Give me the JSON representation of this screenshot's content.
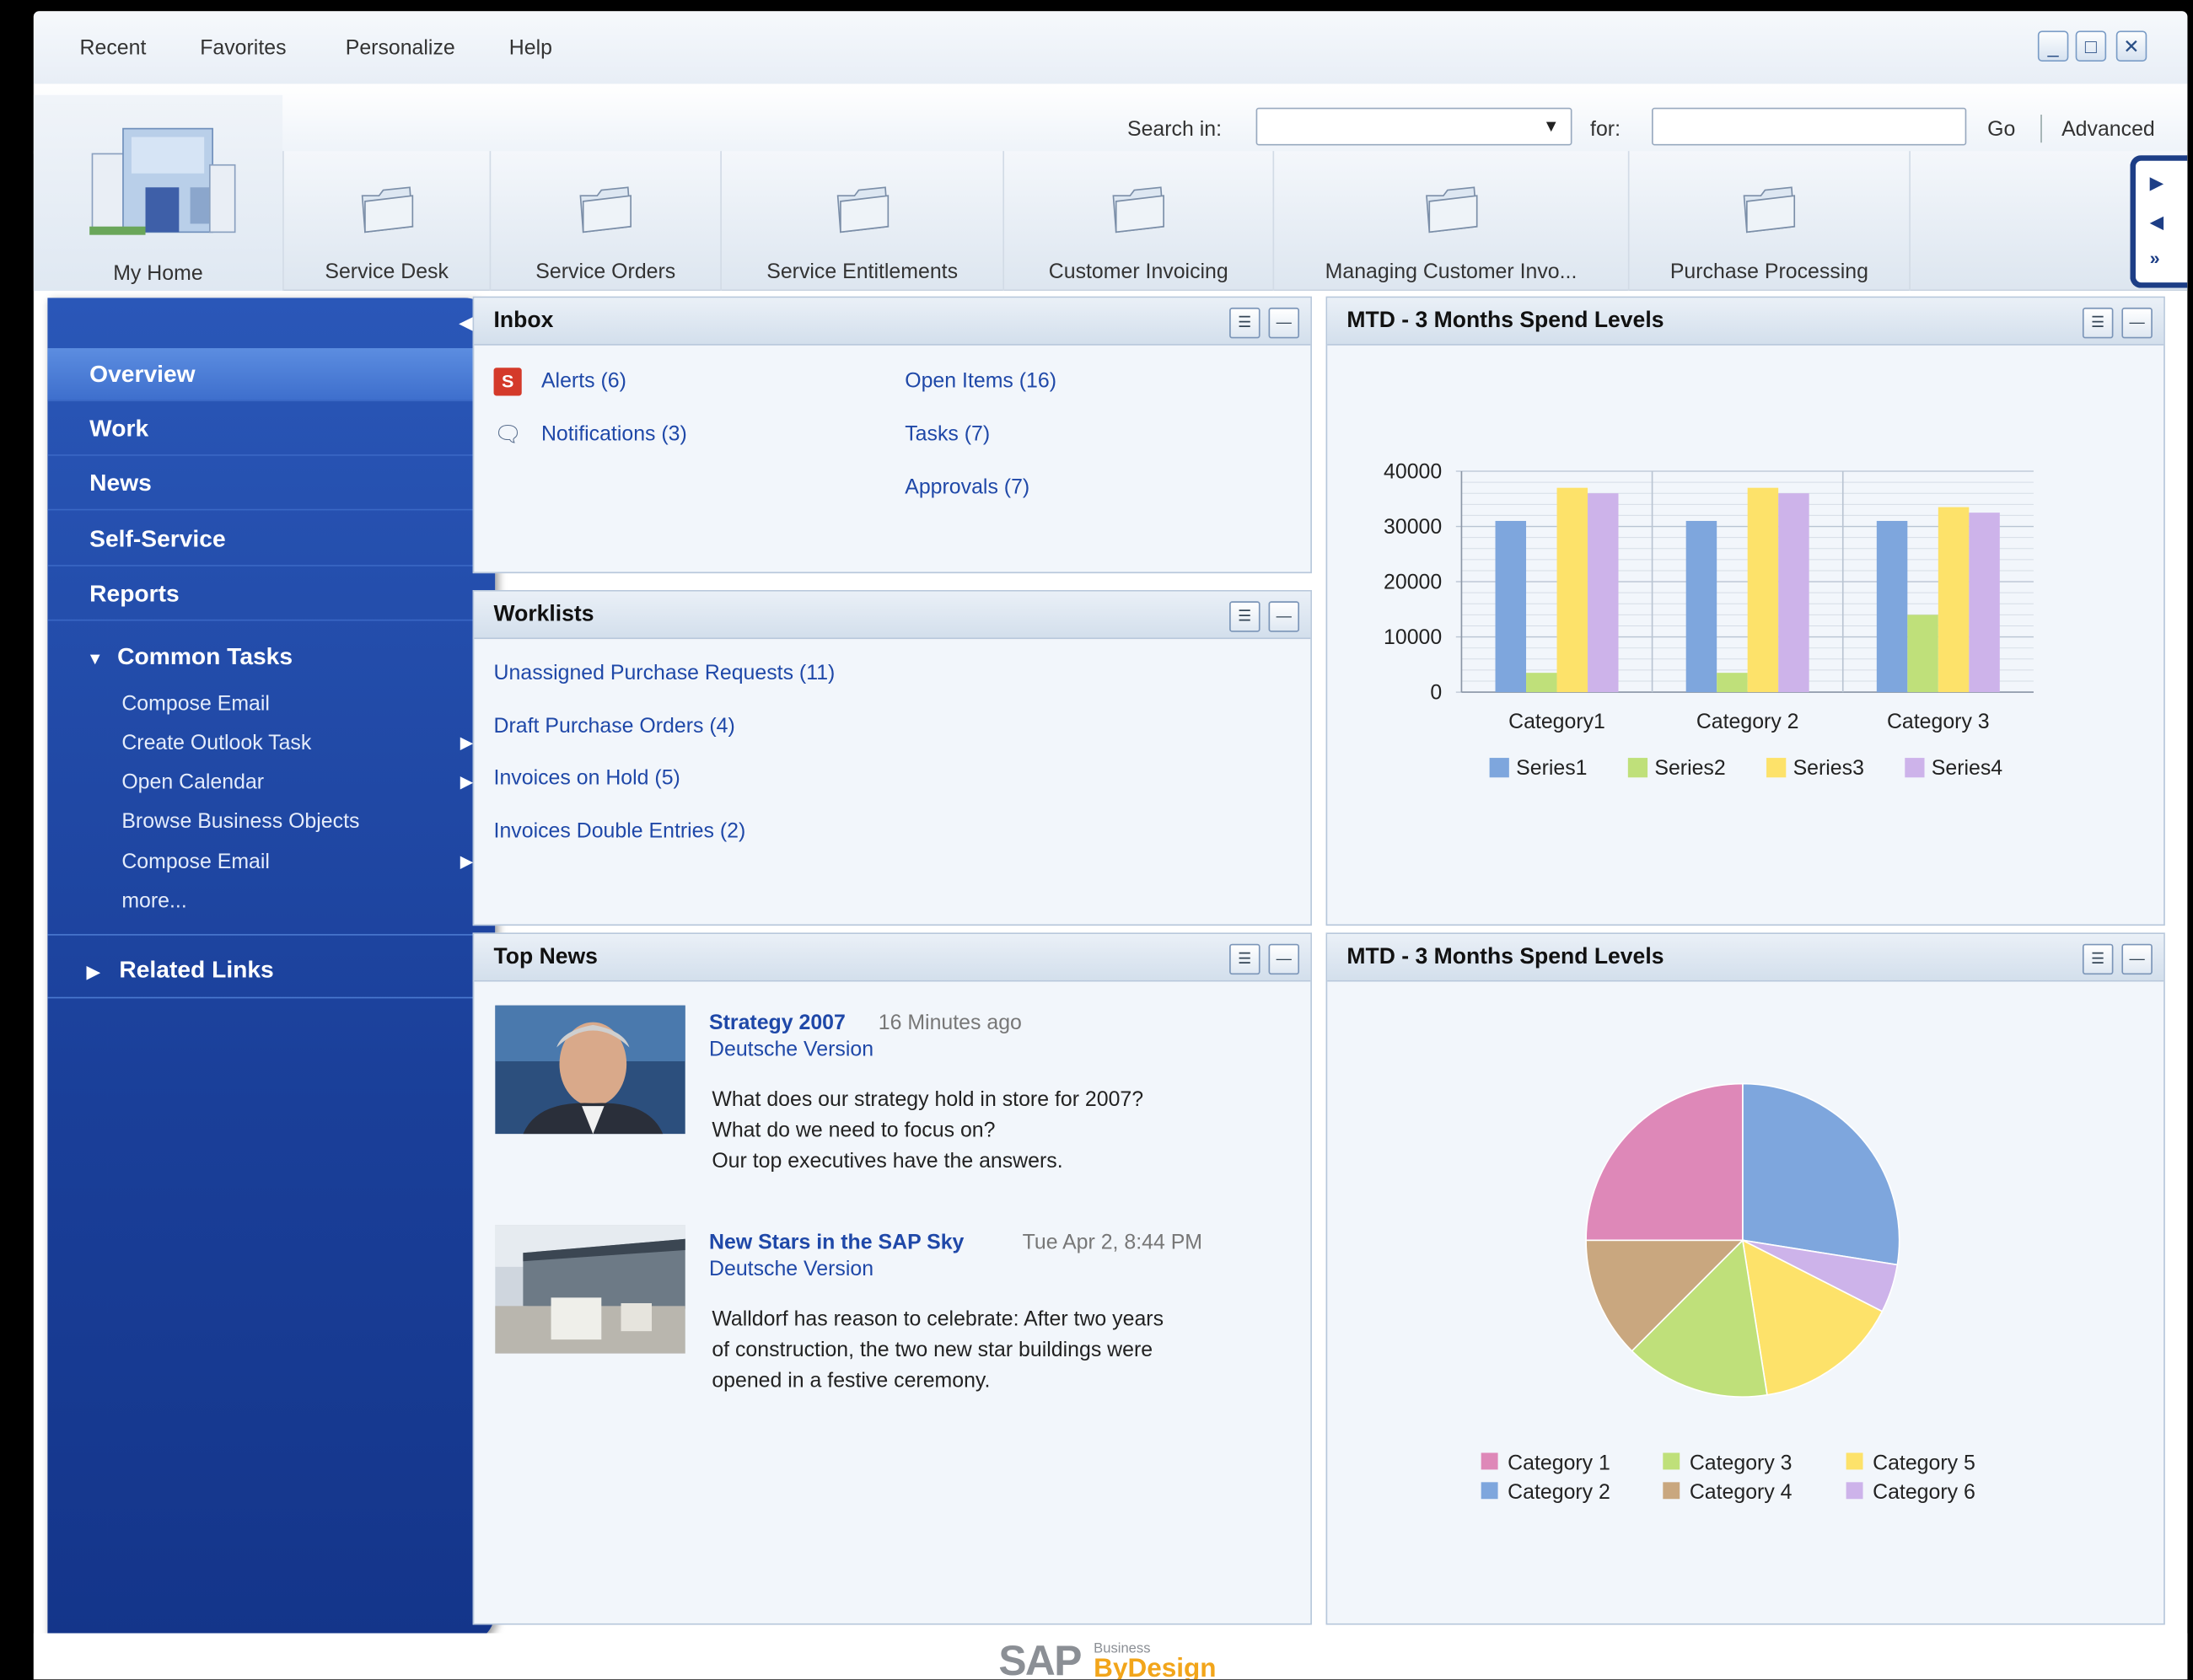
{
  "menu": {
    "recent": "Recent",
    "favorites": "Favorites",
    "personalize": "Personalize",
    "help": "Help"
  },
  "window_controls": {
    "minimize": "_",
    "maximize": "□",
    "close": "✕"
  },
  "search": {
    "search_in_label": "Search in:",
    "selected_value": "",
    "for_label": "for:",
    "for_value": "",
    "go": "Go",
    "advanced": "Advanced"
  },
  "nav": {
    "my_home": "My Home",
    "tabs": [
      "Service Desk",
      "Service Orders",
      "Service Entitlements",
      "Customer Invoicing",
      "Managing Customer Invo...",
      "Purchase Processing"
    ]
  },
  "sidebar": {
    "items": [
      "Overview",
      "Work",
      "News",
      "Self-Service",
      "Reports"
    ],
    "common_tasks_title": "Common Tasks",
    "tasks": [
      "Compose Email",
      "Create Outlook Task",
      "Open Calendar",
      "Browse Business Objects",
      "Compose Email",
      "more..."
    ],
    "related_links": "Related Links"
  },
  "inbox": {
    "title": "Inbox",
    "alerts": "Alerts (6)",
    "notifications": "Notifications (3)",
    "open_items": "Open Items (16)",
    "tasks": "Tasks (7)",
    "approvals": "Approvals (7)"
  },
  "worklists": {
    "title": "Worklists",
    "items": [
      "Unassigned Purchase Requests (11)",
      "Draft Purchase Orders (4)",
      "Invoices on Hold (5)",
      "Invoices Double Entries (2)"
    ]
  },
  "top_news": {
    "title": "Top News",
    "items": [
      {
        "title": "Strategy 2007",
        "meta": "16 Minutes ago",
        "sub": "Deutsche Version",
        "body": [
          "What does our strategy hold in store for 2007?",
          "What do we need to focus on?",
          "Our top executives have the answers."
        ]
      },
      {
        "title": "New Stars in the SAP Sky",
        "meta": "Tue Apr 2, 8:44 PM",
        "sub": "Deutsche Version",
        "body": [
          "Walldorf has reason to celebrate: After two years",
          "of construction, the two new star buildings were",
          "opened in a festive ceremony."
        ]
      }
    ]
  },
  "chart_data": [
    {
      "type": "bar",
      "title": "MTD - 3 Months Spend Levels",
      "categories": [
        "Category1",
        "Category 2",
        "Category 3"
      ],
      "series": [
        {
          "name": "Series1",
          "values": [
            31000,
            31000,
            31000
          ],
          "color": "#7ea6dd"
        },
        {
          "name": "Series2",
          "values": [
            3500,
            3500,
            14000
          ],
          "color": "#bfe07a"
        },
        {
          "name": "Series3",
          "values": [
            37000,
            37000,
            33500
          ],
          "color": "#fde26a"
        },
        {
          "name": "Series4",
          "values": [
            36000,
            36000,
            32500
          ],
          "color": "#cdb3ea"
        }
      ],
      "yticks": [
        0,
        10000,
        20000,
        30000,
        40000
      ],
      "ylim": [
        0,
        40000
      ],
      "legend": "bottom"
    },
    {
      "type": "pie",
      "title": "MTD - 3 Months Spend Levels",
      "slices": [
        {
          "name": "Category 2",
          "value": 27.5,
          "color": "#7ea6dd"
        },
        {
          "name": "Category 6",
          "value": 5,
          "color": "#cdb3ea"
        },
        {
          "name": "Category 5",
          "value": 15,
          "color": "#fde26a"
        },
        {
          "name": "Category 3",
          "value": 15,
          "color": "#bfe07a"
        },
        {
          "name": "Category 4",
          "value": 12.5,
          "color": "#c9a77f"
        },
        {
          "name": "Category 1",
          "value": 25,
          "color": "#de88b8"
        }
      ],
      "legend_order": [
        "Category 1",
        "Category 3",
        "Category 5",
        "Category 2",
        "Category 4",
        "Category 6"
      ],
      "legend": "bottom"
    }
  ],
  "footer": {
    "brand": "SAP",
    "product_small": "Business",
    "product": "ByDesign"
  }
}
